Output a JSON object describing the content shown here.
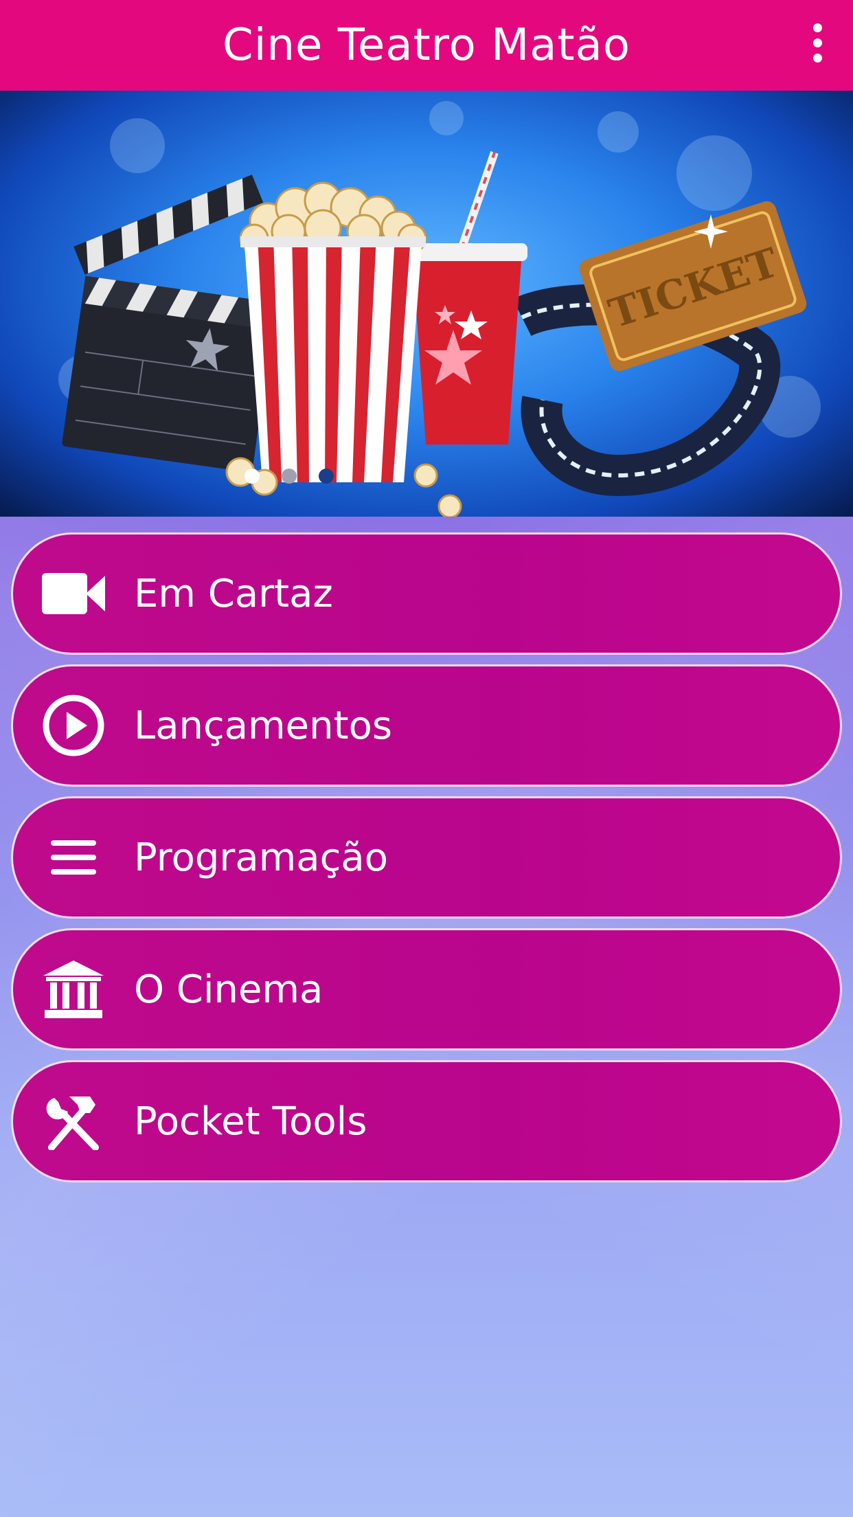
{
  "app": {
    "title": "Cine Teatro Matão"
  },
  "colors": {
    "appbar": "#e4087f",
    "button": "#bb078c",
    "button_border": "#ffffff"
  },
  "carousel": {
    "dots": [
      {
        "active": true,
        "color": "#ffffff"
      },
      {
        "active": false,
        "color": "#a0a0b0"
      },
      {
        "active": false,
        "color": "#1b3d8a"
      }
    ]
  },
  "menu": {
    "items": [
      {
        "label": "Em Cartaz",
        "icon": "video-camera-icon"
      },
      {
        "label": "Lançamentos",
        "icon": "play-circle-icon"
      },
      {
        "label": "Programação",
        "icon": "list-icon"
      },
      {
        "label": "O Cinema",
        "icon": "bank-building-icon"
      },
      {
        "label": "Pocket Tools",
        "icon": "tools-icon"
      }
    ]
  }
}
